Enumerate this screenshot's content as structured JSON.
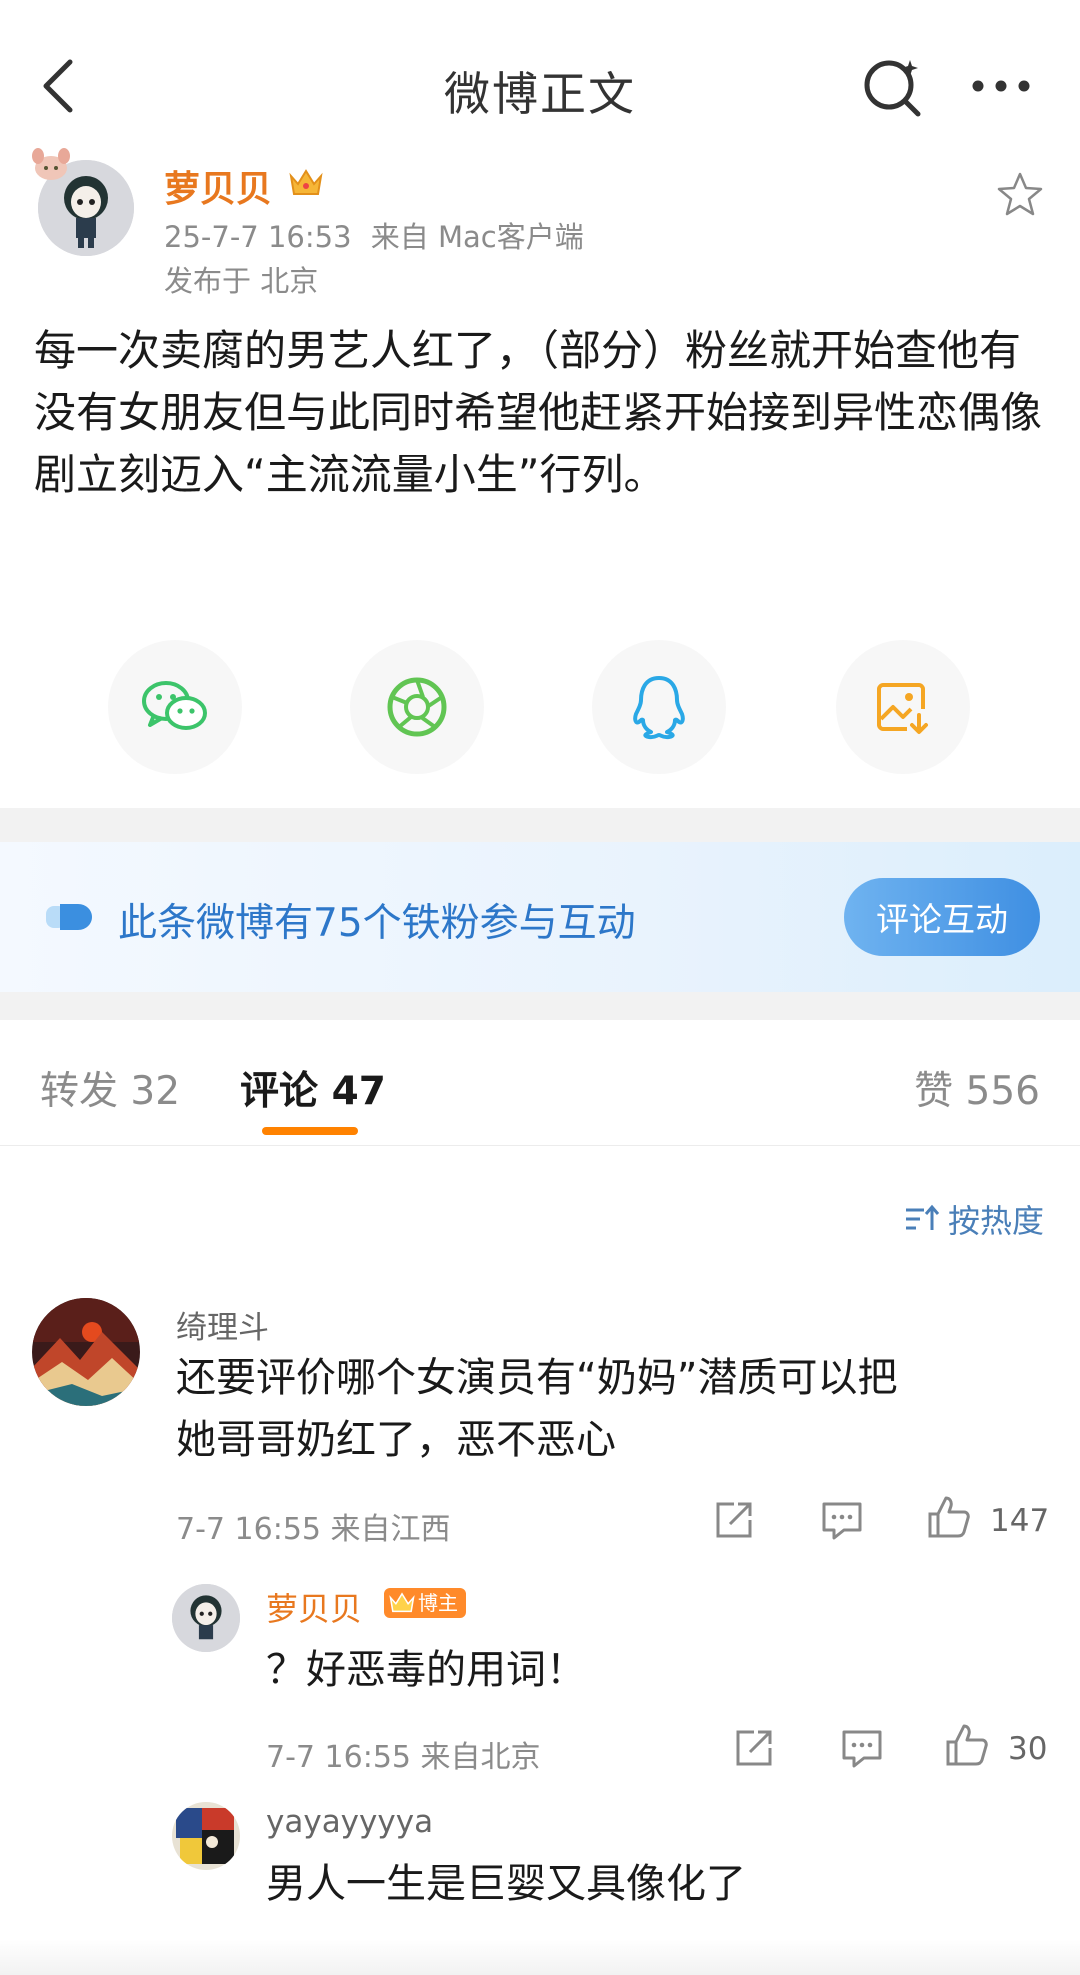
{
  "header": {
    "title": "微博正文"
  },
  "post": {
    "author_name": "萝贝贝",
    "timestamp": "25-7-7 16:53",
    "source": "来自 Mac客户端",
    "location": "发布于 北京",
    "text": "每一次卖腐的男艺人红了，（部分）粉丝就开始查他有没有女朋友但与此同时希望他赶紧开始接到异性恋偶像剧立刻迈入“主流流量小生”行列。"
  },
  "share": {
    "items": [
      {
        "icon": "wechat-icon",
        "color": "#3cc46a"
      },
      {
        "icon": "moments-icon",
        "color": "#61c553"
      },
      {
        "icon": "qq-icon",
        "color": "#2aa8e6"
      },
      {
        "icon": "save-image-icon",
        "color": "#f5a623"
      }
    ]
  },
  "fans_banner": {
    "text": "此条微博有75个铁粉参与互动",
    "button_label": "评论互动"
  },
  "tabs": {
    "repost": "转发 32",
    "comment": "评论 47",
    "like": "赞 556"
  },
  "sort_label": "按热度",
  "comments": [
    {
      "author": "绮理斗",
      "text_line1": "还要评价哪个女演员有“奶妈”潜质可以把",
      "text_line2": "她哥哥奶红了，恶不恶心",
      "meta": "7-7 16:55 来自江西",
      "likes": "147"
    }
  ],
  "replies": [
    {
      "author": "萝贝贝",
      "badge": "博主",
      "text": "？好恶毒的用词！",
      "meta": "7-7 16:55 来自北京",
      "likes": "30"
    },
    {
      "author": "yayayyyya",
      "text": "男人一生是巨婴又具像化了"
    }
  ],
  "colors": {
    "brand_orange": "#ff8200",
    "author_orange": "#e8781f",
    "link_blue": "#2d77c9"
  }
}
